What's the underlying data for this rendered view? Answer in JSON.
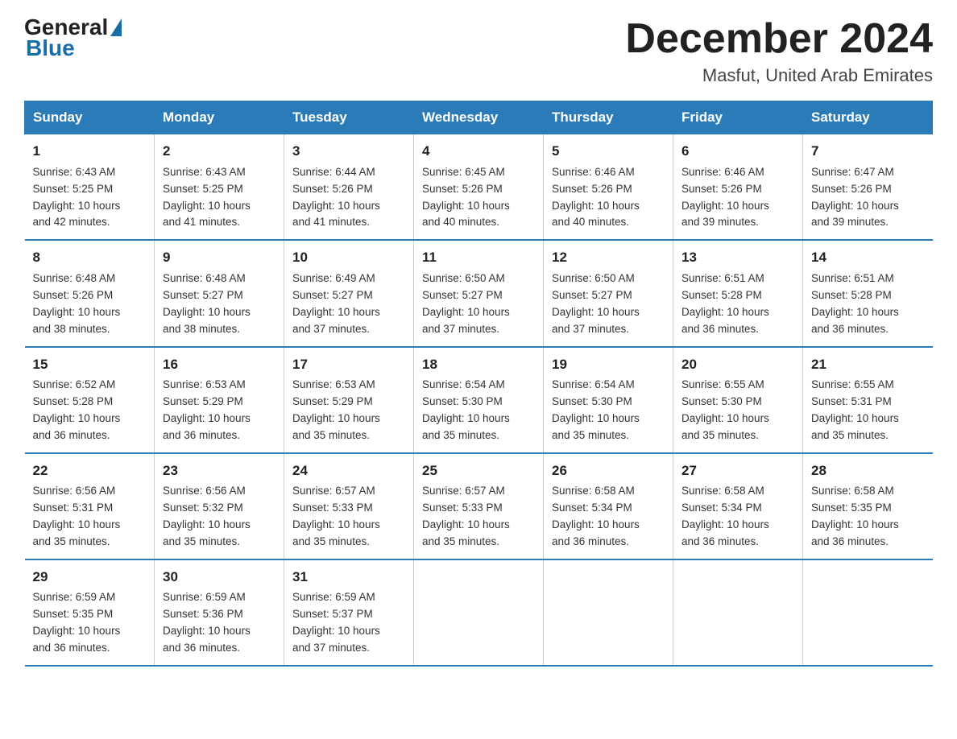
{
  "header": {
    "logo_general": "General",
    "logo_blue": "Blue",
    "month_title": "December 2024",
    "location": "Masfut, United Arab Emirates"
  },
  "calendar": {
    "days_of_week": [
      "Sunday",
      "Monday",
      "Tuesday",
      "Wednesday",
      "Thursday",
      "Friday",
      "Saturday"
    ],
    "weeks": [
      [
        {
          "day": "1",
          "info": "Sunrise: 6:43 AM\nSunset: 5:25 PM\nDaylight: 10 hours\nand 42 minutes."
        },
        {
          "day": "2",
          "info": "Sunrise: 6:43 AM\nSunset: 5:25 PM\nDaylight: 10 hours\nand 41 minutes."
        },
        {
          "day": "3",
          "info": "Sunrise: 6:44 AM\nSunset: 5:26 PM\nDaylight: 10 hours\nand 41 minutes."
        },
        {
          "day": "4",
          "info": "Sunrise: 6:45 AM\nSunset: 5:26 PM\nDaylight: 10 hours\nand 40 minutes."
        },
        {
          "day": "5",
          "info": "Sunrise: 6:46 AM\nSunset: 5:26 PM\nDaylight: 10 hours\nand 40 minutes."
        },
        {
          "day": "6",
          "info": "Sunrise: 6:46 AM\nSunset: 5:26 PM\nDaylight: 10 hours\nand 39 minutes."
        },
        {
          "day": "7",
          "info": "Sunrise: 6:47 AM\nSunset: 5:26 PM\nDaylight: 10 hours\nand 39 minutes."
        }
      ],
      [
        {
          "day": "8",
          "info": "Sunrise: 6:48 AM\nSunset: 5:26 PM\nDaylight: 10 hours\nand 38 minutes."
        },
        {
          "day": "9",
          "info": "Sunrise: 6:48 AM\nSunset: 5:27 PM\nDaylight: 10 hours\nand 38 minutes."
        },
        {
          "day": "10",
          "info": "Sunrise: 6:49 AM\nSunset: 5:27 PM\nDaylight: 10 hours\nand 37 minutes."
        },
        {
          "day": "11",
          "info": "Sunrise: 6:50 AM\nSunset: 5:27 PM\nDaylight: 10 hours\nand 37 minutes."
        },
        {
          "day": "12",
          "info": "Sunrise: 6:50 AM\nSunset: 5:27 PM\nDaylight: 10 hours\nand 37 minutes."
        },
        {
          "day": "13",
          "info": "Sunrise: 6:51 AM\nSunset: 5:28 PM\nDaylight: 10 hours\nand 36 minutes."
        },
        {
          "day": "14",
          "info": "Sunrise: 6:51 AM\nSunset: 5:28 PM\nDaylight: 10 hours\nand 36 minutes."
        }
      ],
      [
        {
          "day": "15",
          "info": "Sunrise: 6:52 AM\nSunset: 5:28 PM\nDaylight: 10 hours\nand 36 minutes."
        },
        {
          "day": "16",
          "info": "Sunrise: 6:53 AM\nSunset: 5:29 PM\nDaylight: 10 hours\nand 36 minutes."
        },
        {
          "day": "17",
          "info": "Sunrise: 6:53 AM\nSunset: 5:29 PM\nDaylight: 10 hours\nand 35 minutes."
        },
        {
          "day": "18",
          "info": "Sunrise: 6:54 AM\nSunset: 5:30 PM\nDaylight: 10 hours\nand 35 minutes."
        },
        {
          "day": "19",
          "info": "Sunrise: 6:54 AM\nSunset: 5:30 PM\nDaylight: 10 hours\nand 35 minutes."
        },
        {
          "day": "20",
          "info": "Sunrise: 6:55 AM\nSunset: 5:30 PM\nDaylight: 10 hours\nand 35 minutes."
        },
        {
          "day": "21",
          "info": "Sunrise: 6:55 AM\nSunset: 5:31 PM\nDaylight: 10 hours\nand 35 minutes."
        }
      ],
      [
        {
          "day": "22",
          "info": "Sunrise: 6:56 AM\nSunset: 5:31 PM\nDaylight: 10 hours\nand 35 minutes."
        },
        {
          "day": "23",
          "info": "Sunrise: 6:56 AM\nSunset: 5:32 PM\nDaylight: 10 hours\nand 35 minutes."
        },
        {
          "day": "24",
          "info": "Sunrise: 6:57 AM\nSunset: 5:33 PM\nDaylight: 10 hours\nand 35 minutes."
        },
        {
          "day": "25",
          "info": "Sunrise: 6:57 AM\nSunset: 5:33 PM\nDaylight: 10 hours\nand 35 minutes."
        },
        {
          "day": "26",
          "info": "Sunrise: 6:58 AM\nSunset: 5:34 PM\nDaylight: 10 hours\nand 36 minutes."
        },
        {
          "day": "27",
          "info": "Sunrise: 6:58 AM\nSunset: 5:34 PM\nDaylight: 10 hours\nand 36 minutes."
        },
        {
          "day": "28",
          "info": "Sunrise: 6:58 AM\nSunset: 5:35 PM\nDaylight: 10 hours\nand 36 minutes."
        }
      ],
      [
        {
          "day": "29",
          "info": "Sunrise: 6:59 AM\nSunset: 5:35 PM\nDaylight: 10 hours\nand 36 minutes."
        },
        {
          "day": "30",
          "info": "Sunrise: 6:59 AM\nSunset: 5:36 PM\nDaylight: 10 hours\nand 36 minutes."
        },
        {
          "day": "31",
          "info": "Sunrise: 6:59 AM\nSunset: 5:37 PM\nDaylight: 10 hours\nand 37 minutes."
        },
        {
          "day": "",
          "info": ""
        },
        {
          "day": "",
          "info": ""
        },
        {
          "day": "",
          "info": ""
        },
        {
          "day": "",
          "info": ""
        }
      ]
    ]
  }
}
